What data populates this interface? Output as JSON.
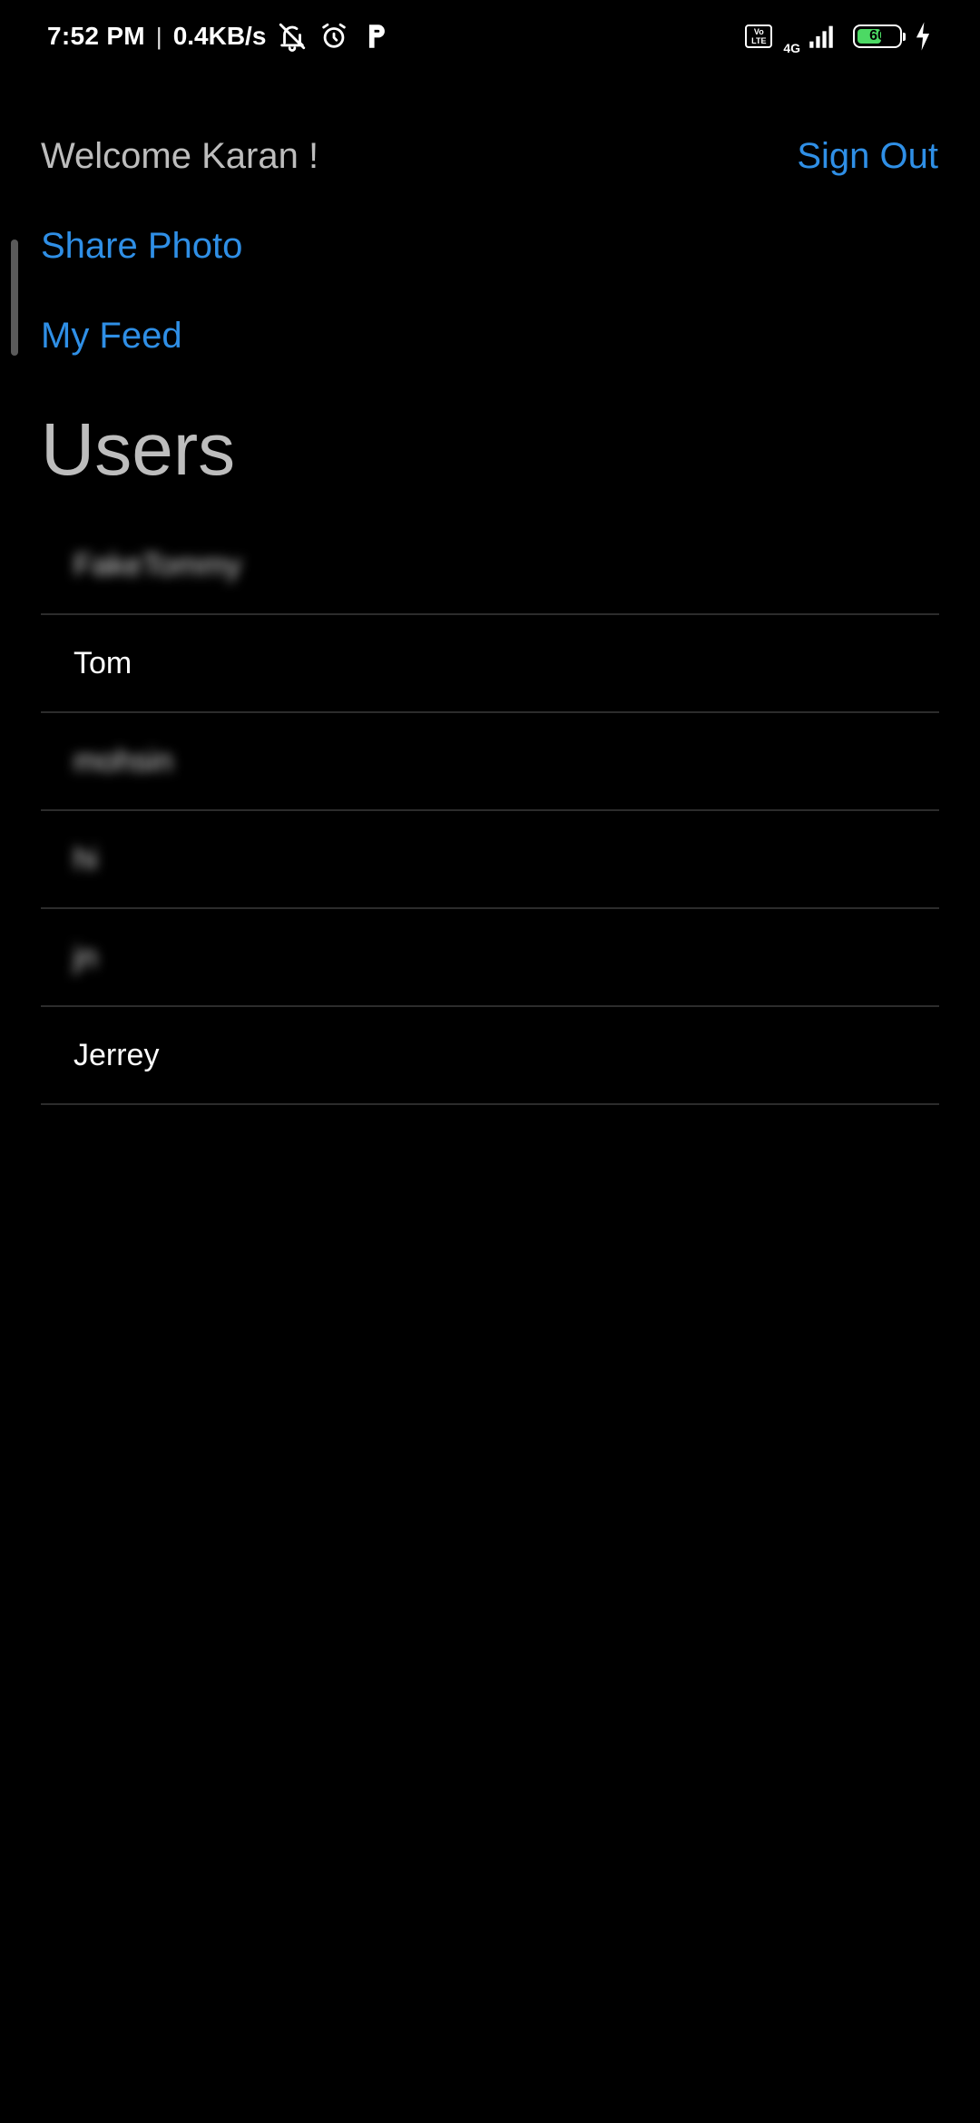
{
  "status_bar": {
    "time": "7:52 PM",
    "separator": "|",
    "net_speed": "0.4KB/s",
    "volte": "Vo LTE",
    "network_type": "4G",
    "battery": "60",
    "battery_level": 0.6,
    "icons": [
      "mute-icon",
      "alarm-icon",
      "p-app-icon",
      "signal-icon",
      "charging-icon"
    ]
  },
  "header": {
    "welcome": "Welcome Karan !",
    "sign_out": "Sign Out"
  },
  "nav": {
    "share_photo": "Share Photo",
    "my_feed": "My Feed"
  },
  "users_title": "Users",
  "users": [
    {
      "name": "FakeTommy",
      "blurred": true
    },
    {
      "name": "Tom",
      "blurred": false
    },
    {
      "name": "mohsin",
      "blurred": true
    },
    {
      "name": "hi",
      "blurred": true
    },
    {
      "name": "jn",
      "blurred": true
    },
    {
      "name": "Jerrey",
      "blurred": false
    }
  ],
  "colors": {
    "background": "#000000",
    "link": "#2f8fe6",
    "muted_text": "#bdbdbd",
    "divider": "#2c2c2c",
    "battery_fill": "#4cd964"
  }
}
